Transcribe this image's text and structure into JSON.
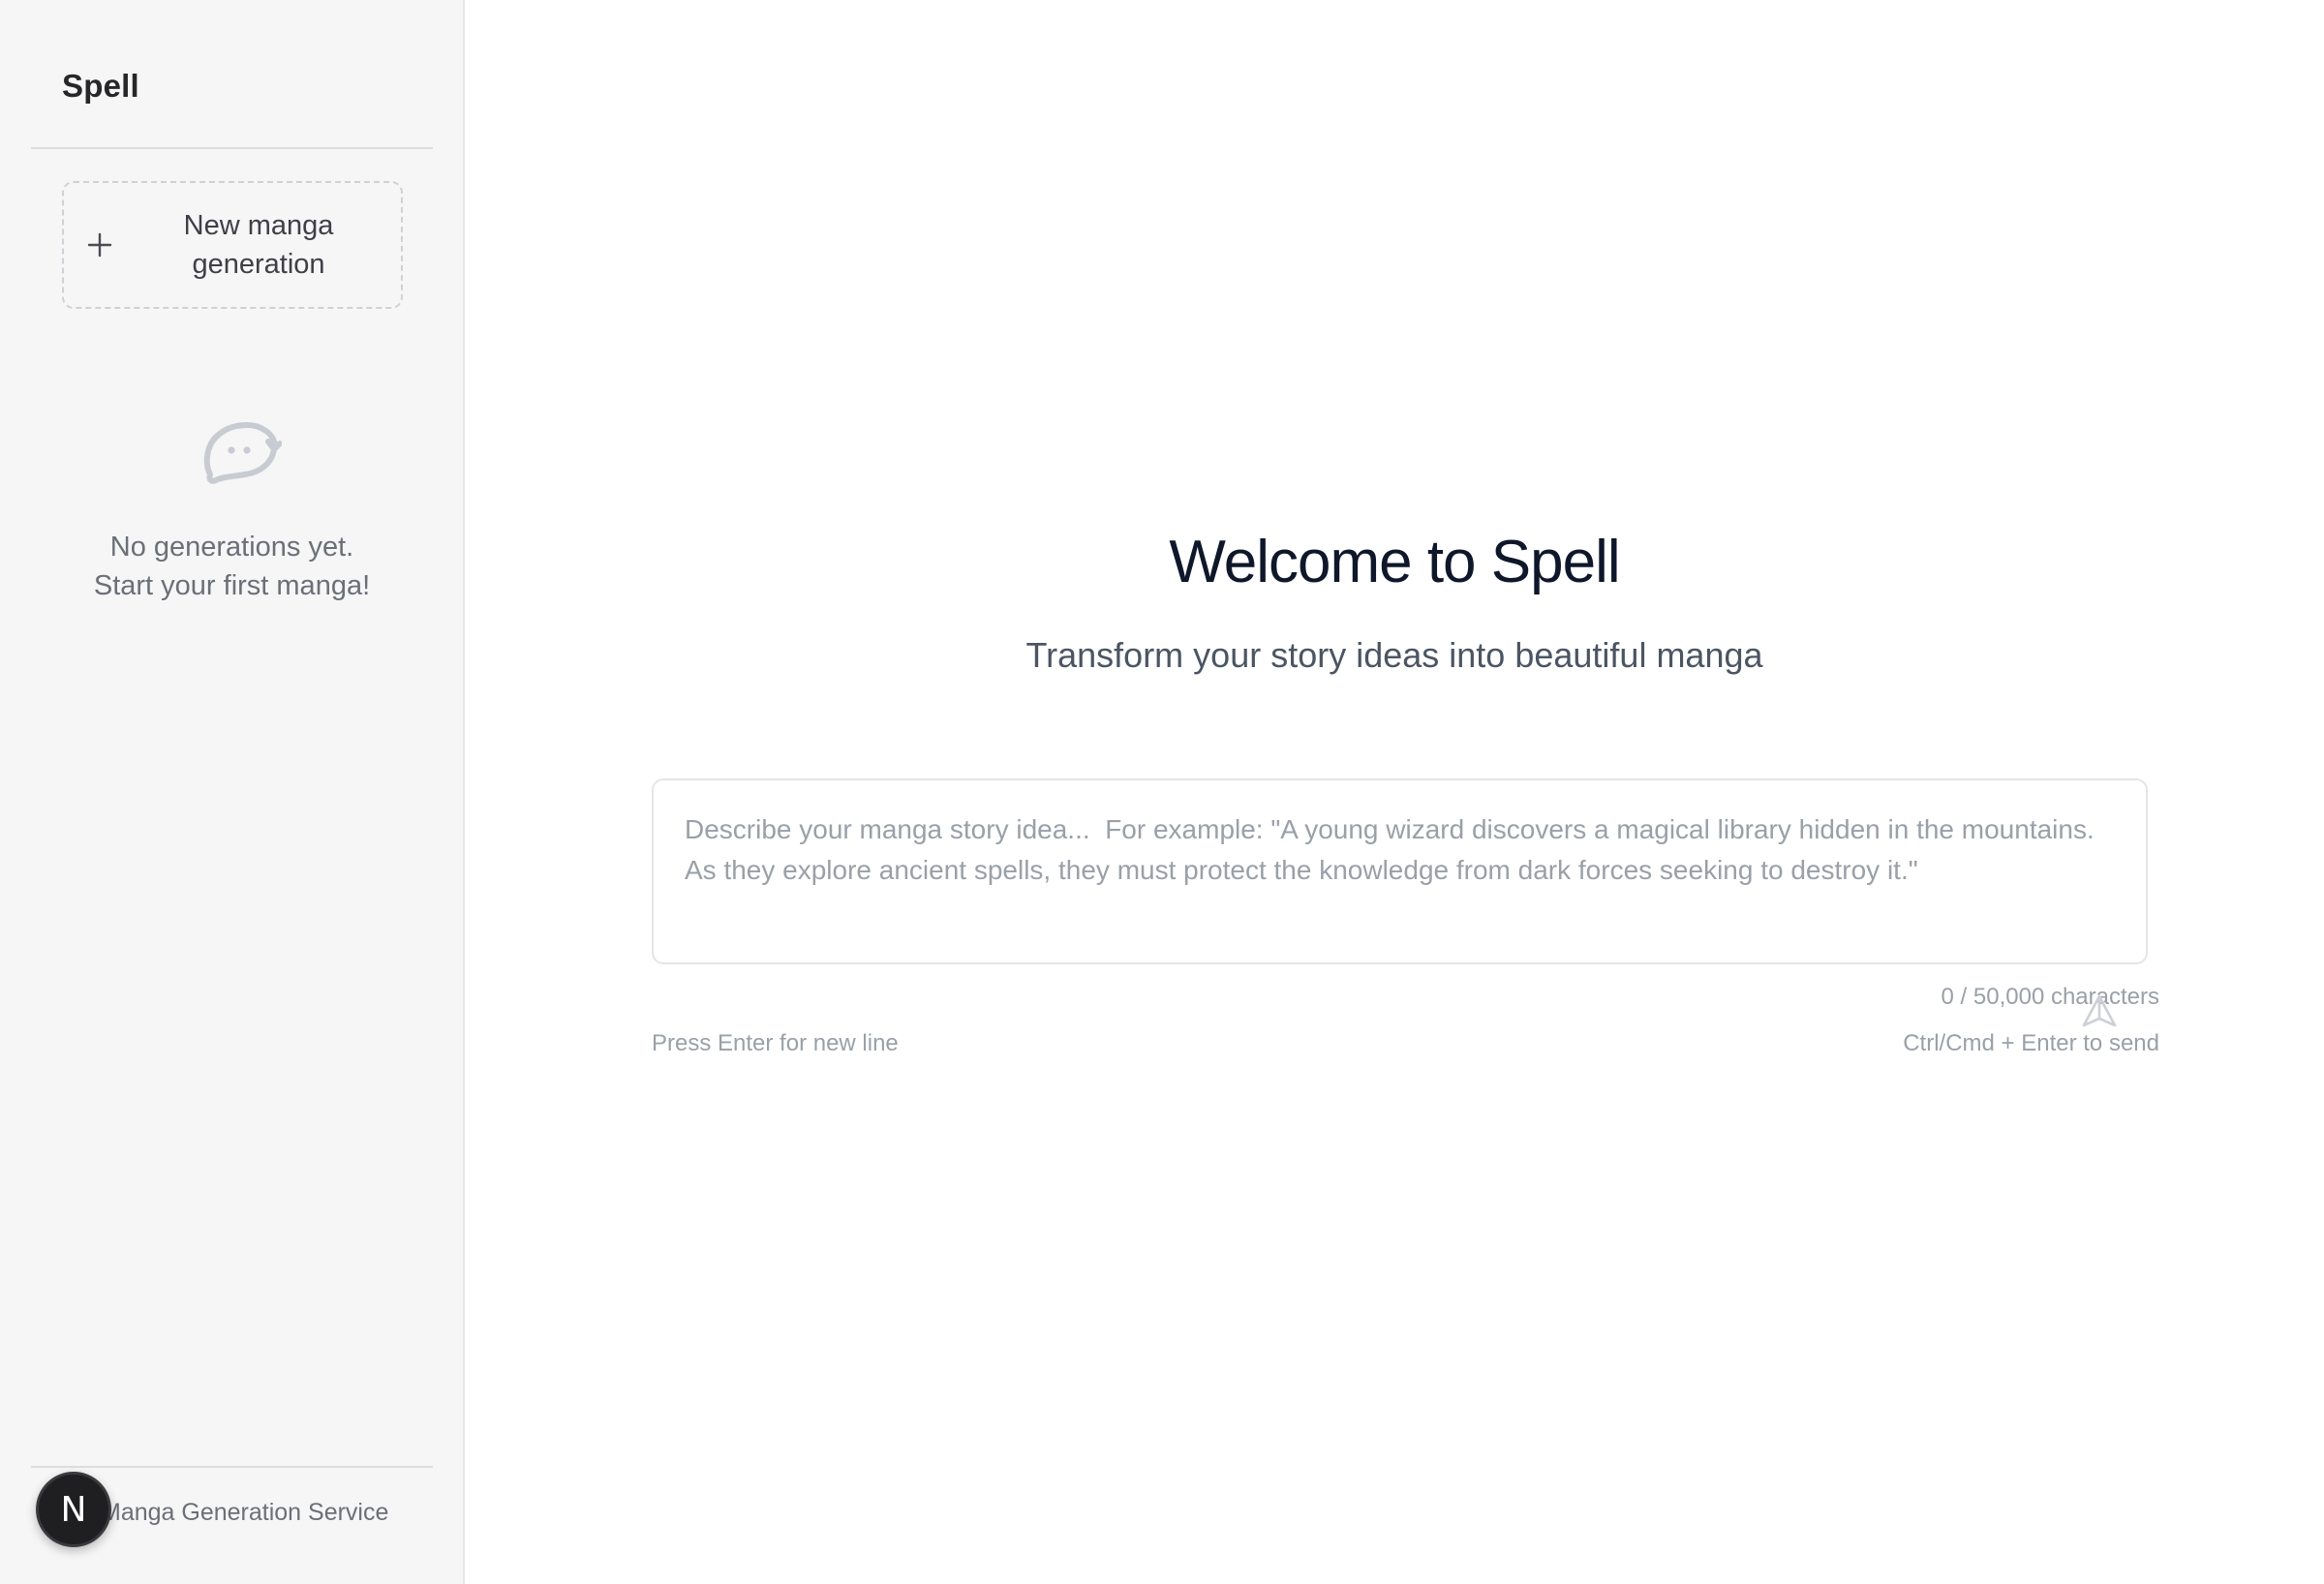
{
  "sidebar": {
    "brand": "Spell",
    "new_button": {
      "label_line1": "New manga",
      "label_line2": "generation",
      "icon": "plus-icon"
    },
    "empty_state": {
      "icon": "chat-bubble-icon",
      "line1": "No generations yet.",
      "line2": "Start your first manga!"
    },
    "footer": {
      "text": "Manga Generation Service",
      "avatar_letter": "N"
    }
  },
  "main": {
    "title": "Welcome to Spell",
    "subtitle": "Transform your story ideas into beautiful manga",
    "prompt": {
      "value": "",
      "placeholder": "Describe your manga story idea...  For example: \"A young wizard discovers a magical library hidden in the mountains. As they explore ancient spells, they must protect the knowledge from dark forces seeking to destroy it.\""
    },
    "char_count": "0 / 50,000 characters",
    "hint_left": "Press Enter for new line",
    "hint_right": "Ctrl/Cmd + Enter to send",
    "send_icon": "send-icon"
  },
  "colors": {
    "sidebar_bg": "#f6f6f7",
    "title": "#0f172a",
    "muted": "#9aa0a8",
    "avatar_bg": "#1f1f22"
  }
}
